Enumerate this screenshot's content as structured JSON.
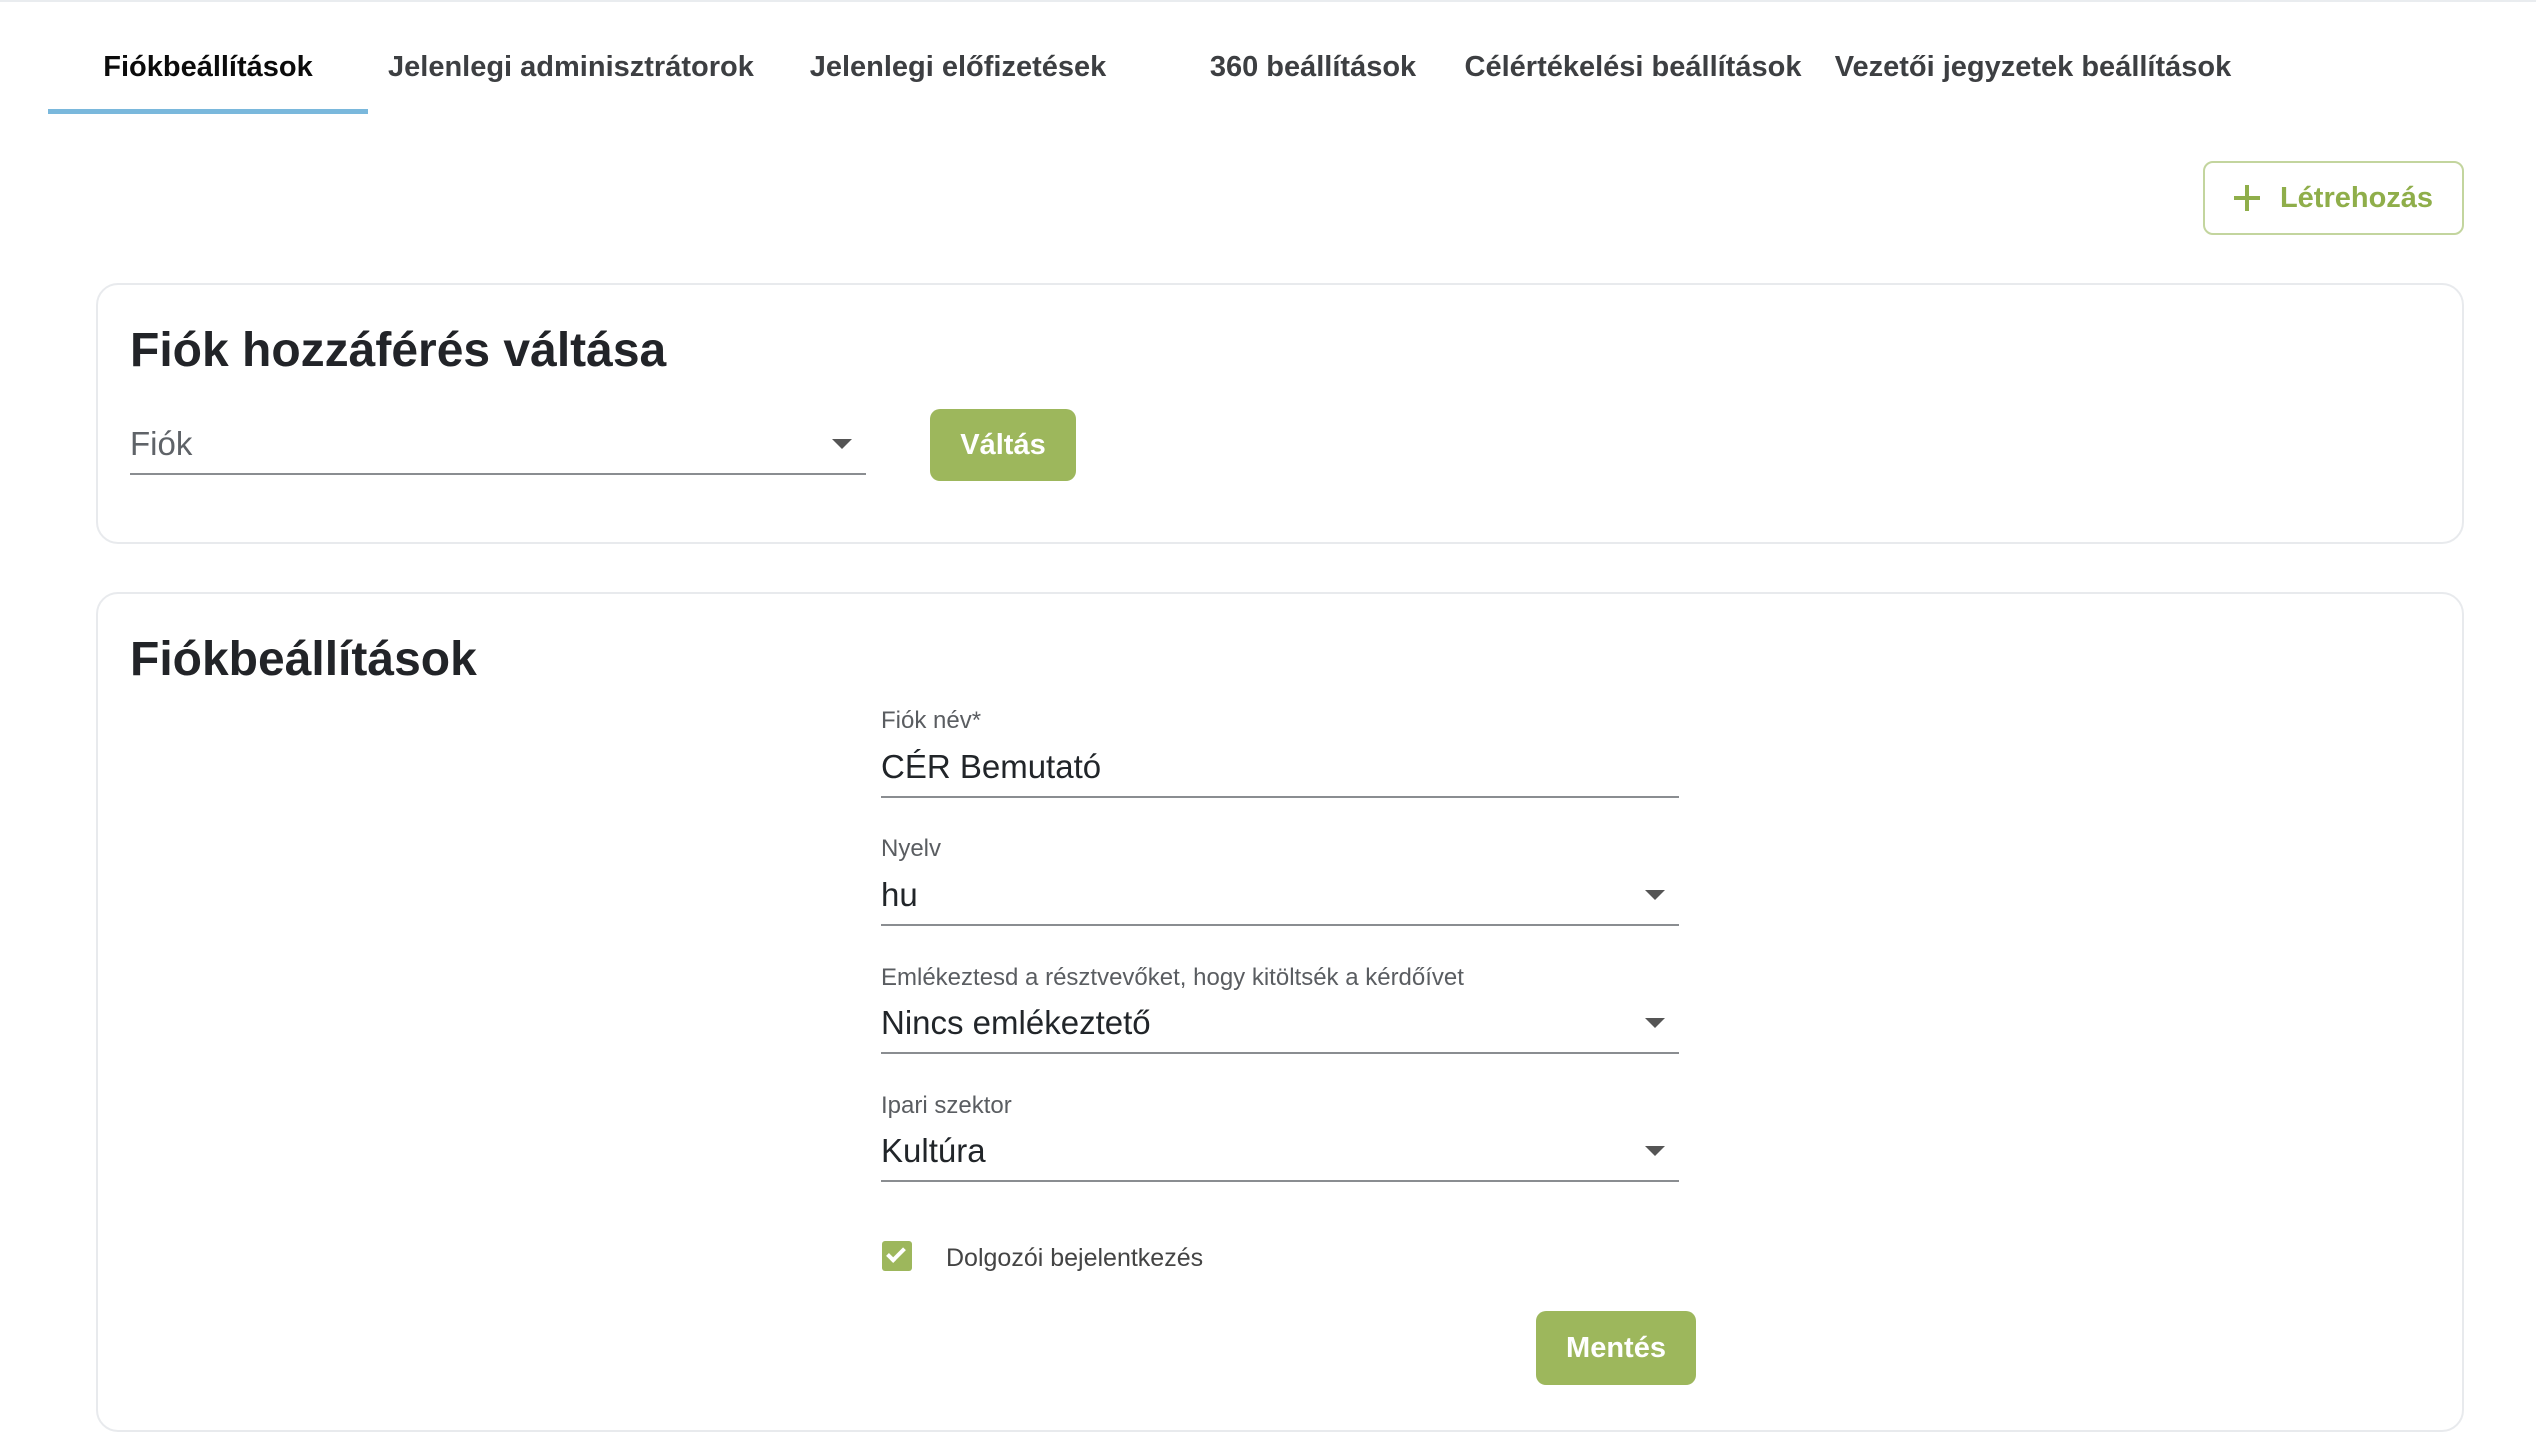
{
  "tabs": [
    {
      "label": "Fiókbeállítások",
      "active": true
    },
    {
      "label": "Jelenlegi adminisztrátorok",
      "active": false
    },
    {
      "label": "Jelenlegi előfizetések",
      "active": false
    },
    {
      "label": "360 beállítások",
      "active": false
    },
    {
      "label": "Célértékelési beállítások",
      "active": false
    },
    {
      "label": "Vezetői jegyzetek beállítások",
      "active": false
    }
  ],
  "toolbar": {
    "create_label": "Létrehozás"
  },
  "switch_card": {
    "title": "Fiók hozzáférés váltása",
    "account_select_placeholder": "Fiók",
    "switch_button": "Váltás"
  },
  "settings_card": {
    "title": "Fiókbeállítások",
    "account_name": {
      "label": "Fiók név*",
      "value": "CÉR Bemutató"
    },
    "language": {
      "label": "Nyelv",
      "value": "hu"
    },
    "reminder": {
      "label": "Emlékeztesd a résztvevőket, hogy kitöltsék a kérdőívet",
      "value": "Nincs emlékeztető"
    },
    "sector": {
      "label": "Ipari szektor",
      "value": "Kultúra"
    },
    "employee_login": {
      "label": "Dolgozói bejelentkezés",
      "checked": true
    },
    "save_button": "Mentés"
  },
  "colors": {
    "accent": "#9db75c",
    "tab_indicator": "#7ab8dc",
    "outline_button": "#c3d59e"
  }
}
